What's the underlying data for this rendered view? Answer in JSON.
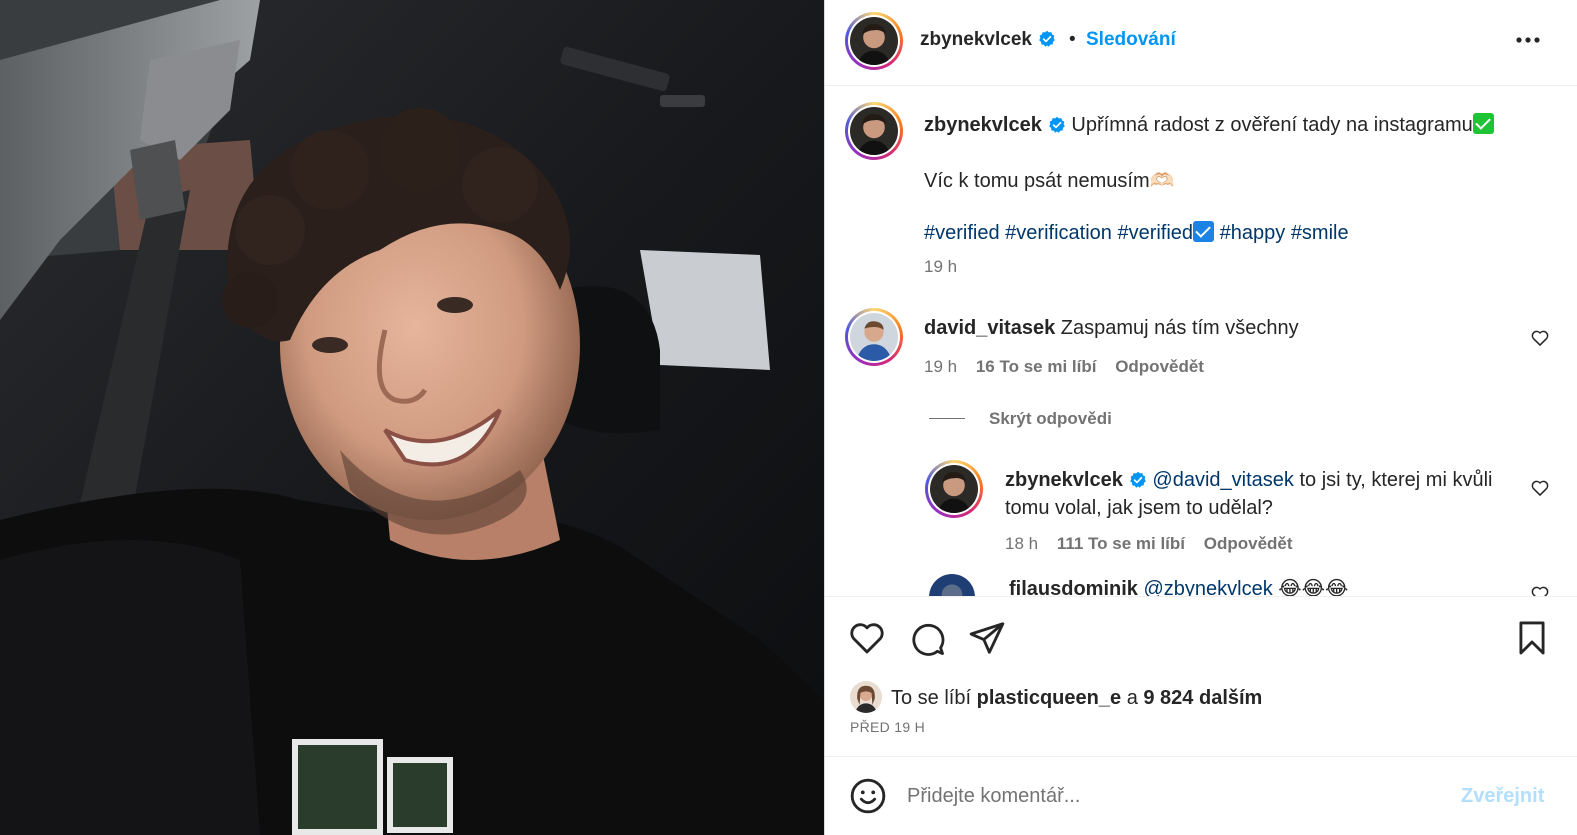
{
  "header": {
    "username": "zbynekvlcek",
    "separator": "•",
    "follow_label": "Sledování",
    "more_icon": "more-horizontal-icon"
  },
  "caption": {
    "username": "zbynekvlcek",
    "text": "Upřímná radost z ověření tady na instagramu",
    "line2": "Víc k tomu psát nemusím🫶🏻",
    "tags": [
      "#verified",
      "#verification",
      "#verified"
    ],
    "tags2": [
      "#happy",
      "#smile"
    ],
    "time": "19 h"
  },
  "comments": [
    {
      "username": "david_vitasek",
      "text": "Zaspamuj nás tím všechny",
      "time": "19 h",
      "likes": "16 To se mi líbí",
      "reply_label": "Odpovědět"
    }
  ],
  "hide_replies_label": "Skrýt odpovědi",
  "reply": {
    "username": "zbynekvlcek",
    "mention": "@david_vitasek",
    "text": " to jsi ty, kterej mi kvůli tomu volal, jak jsem to udělal?",
    "time": "18 h",
    "likes": "111 To se mi líbí",
    "reply_label": "Odpovědět"
  },
  "partial_comment": {
    "username": "filausdominik",
    "mention": "@zbynekvlcek",
    "emoji": "😂😂😂"
  },
  "likes": {
    "prefix": "To se líbí",
    "user": "plasticqueen_e",
    "conj": "a",
    "count": "9 824 dalším"
  },
  "post_date": "PŘED 19 H",
  "add_comment": {
    "placeholder": "Přidejte komentář...",
    "post_label": "Zveřejnit"
  },
  "colors": {
    "link_blue": "#0095f6",
    "hashtag": "#00376b",
    "muted": "#737373",
    "post_disabled": "#b2dffc"
  }
}
